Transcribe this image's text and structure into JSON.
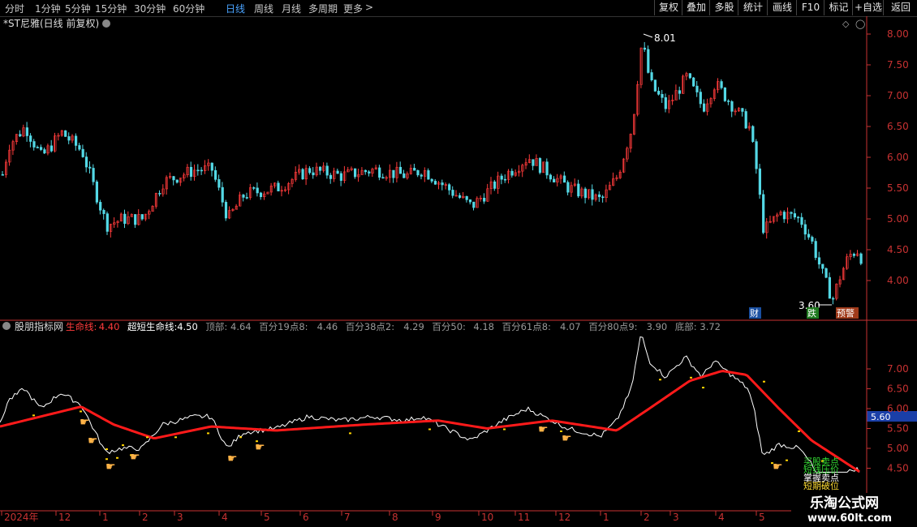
{
  "toolbar": {
    "period_tabs": [
      "分时",
      "1分钟",
      "5分钟",
      "15分钟",
      "30分钟",
      "60分钟",
      "日线",
      "周线",
      "月线",
      "多周期",
      "更多"
    ],
    "active_tab": "日线",
    "right_buttons": [
      "复权",
      "叠加",
      "多股",
      "统计",
      "画线",
      "F10",
      "标记",
      "+自选",
      "返回"
    ]
  },
  "main_panel": {
    "title": "*ST尼雅(日线 前复权)",
    "price_axis": [
      "8.00",
      "7.50",
      "7.00",
      "6.50",
      "6.00",
      "5.50",
      "5.00",
      "4.50",
      "4.00"
    ],
    "high_marker": "8.01",
    "low_marker": "3.60",
    "badges": [
      "财",
      "跌",
      "预警"
    ]
  },
  "indicator_panel": {
    "name": "股朋指标网",
    "values": [
      {
        "label": "生命线:",
        "value": "4.40",
        "color": "#ff3b3b"
      },
      {
        "label": "超短生命线:",
        "value": "4.50",
        "color": "#ffffff"
      },
      {
        "label": "顶部:",
        "value": "4.64",
        "color": "#999999"
      },
      {
        "label": "百分19点8:",
        "value": "4.46",
        "color": "#999999"
      },
      {
        "label": "百分38点2:",
        "value": "4.29",
        "color": "#999999"
      },
      {
        "label": "百分50:",
        "value": "4.18",
        "color": "#999999"
      },
      {
        "label": "百分61点8:",
        "value": "4.07",
        "color": "#999999"
      },
      {
        "label": "百分80点9:",
        "value": "3.90",
        "color": "#999999"
      },
      {
        "label": "底部:",
        "value": "3.72",
        "color": "#999999"
      }
    ],
    "axis": [
      "7.00",
      "6.50",
      "6.00",
      "5.50",
      "5.00",
      "4.50"
    ],
    "current_price_tag": "5.60",
    "signal_labels": [
      "买股卖点",
      "短线压价",
      "掌握卖点",
      "短期破位"
    ]
  },
  "date_axis": [
    "2024年",
    "12",
    "1",
    "2",
    "3",
    "4",
    "5",
    "6",
    "7",
    "8",
    "9",
    "10",
    "11",
    "12",
    "1",
    "2",
    "3",
    "4",
    "5"
  ],
  "watermark": {
    "line1": "乐淘公式网",
    "line2": "www.60lt.com"
  },
  "colors": {
    "up": "#ff3b3b",
    "down": "#54d9e6",
    "axis": "#c83232",
    "life_line": "#ff1a1a",
    "short_line": "#ffffff",
    "active": "#4aa3ff"
  }
}
